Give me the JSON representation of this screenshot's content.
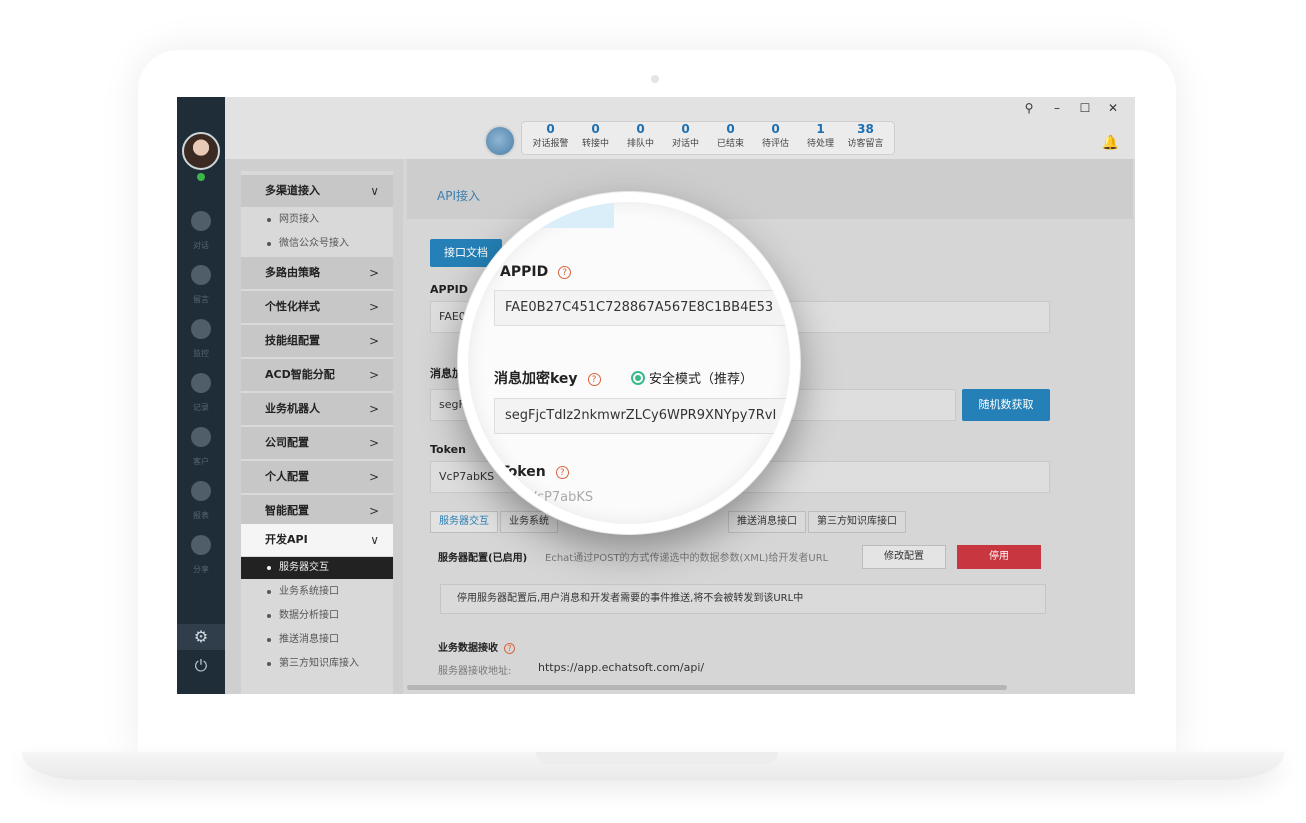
{
  "window": {
    "controls": [
      "⚲",
      "–",
      "☐",
      "✕"
    ]
  },
  "stats": [
    {
      "num": "0",
      "label": "对话报警"
    },
    {
      "num": "0",
      "label": "转接中"
    },
    {
      "num": "0",
      "label": "排队中"
    },
    {
      "num": "0",
      "label": "对话中"
    },
    {
      "num": "0",
      "label": "已结束"
    },
    {
      "num": "0",
      "label": "待评估"
    },
    {
      "num": "1",
      "label": "待处理"
    },
    {
      "num": "38",
      "label": "访客留言"
    }
  ],
  "rail": [
    {
      "label": "对话",
      "icon": "chat-icon"
    },
    {
      "label": "留言",
      "icon": "mail-icon"
    },
    {
      "label": "监控",
      "icon": "eye-icon"
    },
    {
      "label": "记录",
      "icon": "clock-icon"
    },
    {
      "label": "客户",
      "icon": "contact-card-icon"
    },
    {
      "label": "报表",
      "icon": "pie-chart-icon"
    },
    {
      "label": "分享",
      "icon": "share-icon"
    }
  ],
  "rail_bottom": {
    "settings_glyph": "⚙",
    "power_glyph": "⏻"
  },
  "menu": {
    "groups": [
      {
        "label": "多渠道接入",
        "chevron": "∨"
      },
      {
        "label": "多路由策略",
        "chevron": ">"
      },
      {
        "label": "个性化样式",
        "chevron": ">"
      },
      {
        "label": "技能组配置",
        "chevron": ">"
      },
      {
        "label": "ACD智能分配",
        "chevron": ">"
      },
      {
        "label": "业务机器人",
        "chevron": ">"
      },
      {
        "label": "公司配置",
        "chevron": ">"
      },
      {
        "label": "个人配置",
        "chevron": ">"
      },
      {
        "label": "智能配置",
        "chevron": ">"
      },
      {
        "label": "开发API",
        "chevron": "∨"
      }
    ],
    "channel_subs": [
      "网页接入",
      "微信公众号接入"
    ],
    "api_subs": [
      "服务器交互",
      "业务系统接口",
      "数据分析接口",
      "推送消息接口",
      "第三方知识库接入"
    ]
  },
  "content": {
    "title": "API接入",
    "doc_button": "接口文档",
    "appid_label": "APPID",
    "appid_value": "FAE0",
    "key_label": "消息加",
    "key_value": "segF",
    "random_button": "随机数获取",
    "token_label": "Token",
    "token_value": "VcP7abKS",
    "subtabs": [
      "服务器交互",
      "业务系统",
      "推送消息接口",
      "第三方知识库接口"
    ],
    "server_title": "服务器配置(已启用)",
    "server_desc": "Echat通过POST的方式传递选中的数据参数(XML)给开发者URL",
    "edit_button": "修改配置",
    "stop_button": "停用",
    "notice": "停用服务器配置后,用户消息和开发者需要的事件推送,将不会被转发到该URL中",
    "biz_title": "业务数据接收",
    "biz_url_label": "服务器接收地址:",
    "biz_url": "https://app.echatsoft.com/api/"
  },
  "lens": {
    "appid_label": "APPID",
    "appid_value": "FAE0B27C451C728867A567E8C1BB4E53",
    "key_label": "消息加密key",
    "mode_label": "安全模式（推荐）",
    "key_value": "segFjcTdIz2nkmwrZLCy6WPR9XNYpy7RvI",
    "token_label": "Token",
    "token_value": "VcP7abKS"
  },
  "colors": {
    "accent": "#2480b6",
    "danger": "#c8373f",
    "rail": "#1f2d38",
    "radio": "#3ab98a"
  }
}
